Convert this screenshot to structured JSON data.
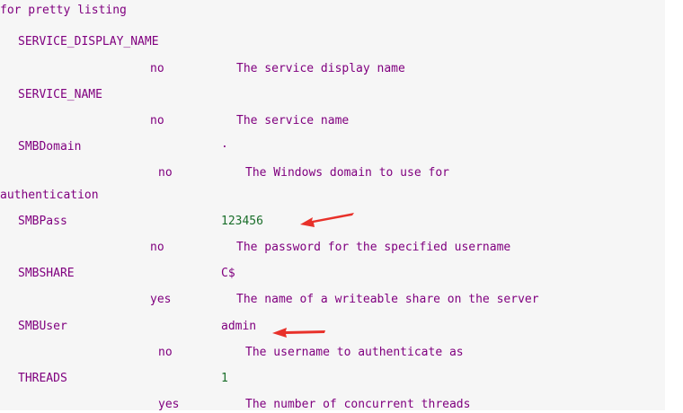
{
  "heading": "for pretty listing",
  "wrap_text": "authentication",
  "options": [
    {
      "name": "SERVICE_DISPLAY_NAME",
      "value": "",
      "required": "no",
      "description": "The service display name"
    },
    {
      "name": "SERVICE_NAME",
      "value": "",
      "required": "no",
      "description": "The service name"
    },
    {
      "name": "SMBDomain",
      "value": ".",
      "required": "no",
      "description": "The Windows domain to use for"
    },
    {
      "name": "SMBPass",
      "value": "123456",
      "required": "no",
      "description": "The password for the specified username"
    },
    {
      "name": "SMBSHARE",
      "value": "C$",
      "required": "yes",
      "description": "The name of a writeable share on the server"
    },
    {
      "name": "SMBUser",
      "value": "admin",
      "required": "no",
      "description": "The username to authenticate as"
    },
    {
      "name": "THREADS",
      "value": "1",
      "required": "yes",
      "description": "The number of concurrent threads"
    }
  ],
  "colors": {
    "text": "#80007f",
    "value": "#1a6e2a",
    "arrow": "#e8312a",
    "background": "#f6f6f6"
  }
}
